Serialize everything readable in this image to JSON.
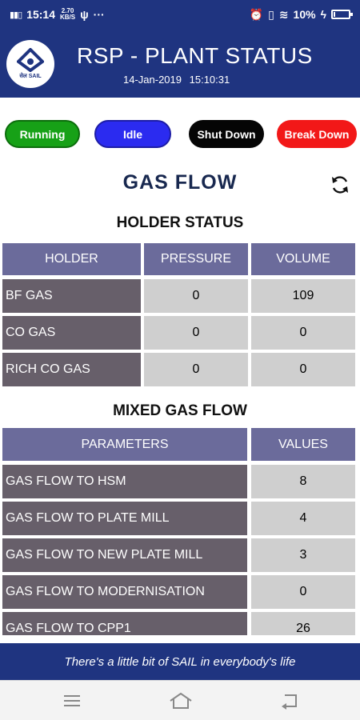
{
  "status_bar": {
    "time": "15:14",
    "speed_top": "2.70",
    "speed_bottom": "KB/S",
    "battery": "10%",
    "battery_level": 0.1
  },
  "header": {
    "title": "RSP - PLANT STATUS",
    "date": "14-Jan-2019",
    "time": "15:10:31",
    "logo_text": "सेल SAIL"
  },
  "legend": {
    "running": "Running",
    "idle": "Idle",
    "shut_down": "Shut Down",
    "break_down": "Break Down"
  },
  "gas_flow_title": "GAS FLOW",
  "holder_status": {
    "title": "HOLDER STATUS",
    "columns": [
      "HOLDER",
      "PRESSURE",
      "VOLUME"
    ],
    "rows": [
      {
        "name": "BF GAS",
        "pressure": "0",
        "volume": "109"
      },
      {
        "name": "CO GAS",
        "pressure": "0",
        "volume": "0"
      },
      {
        "name": "RICH CO GAS",
        "pressure": "0",
        "volume": "0"
      }
    ]
  },
  "mixed_gas_flow": {
    "title": "MIXED GAS FLOW",
    "columns": [
      "PARAMETERS",
      "VALUES"
    ],
    "rows": [
      {
        "name": "GAS FLOW TO HSM",
        "value": "8"
      },
      {
        "name": "GAS FLOW TO PLATE MILL",
        "value": "4"
      },
      {
        "name": "GAS FLOW TO NEW PLATE MILL",
        "value": "3"
      },
      {
        "name": "GAS FLOW TO MODERNISATION",
        "value": "0"
      },
      {
        "name": "GAS FLOW TO CPP1",
        "value": "26"
      }
    ]
  },
  "footer": {
    "tagline": "There's a little bit of SAIL in everybody's life"
  }
}
